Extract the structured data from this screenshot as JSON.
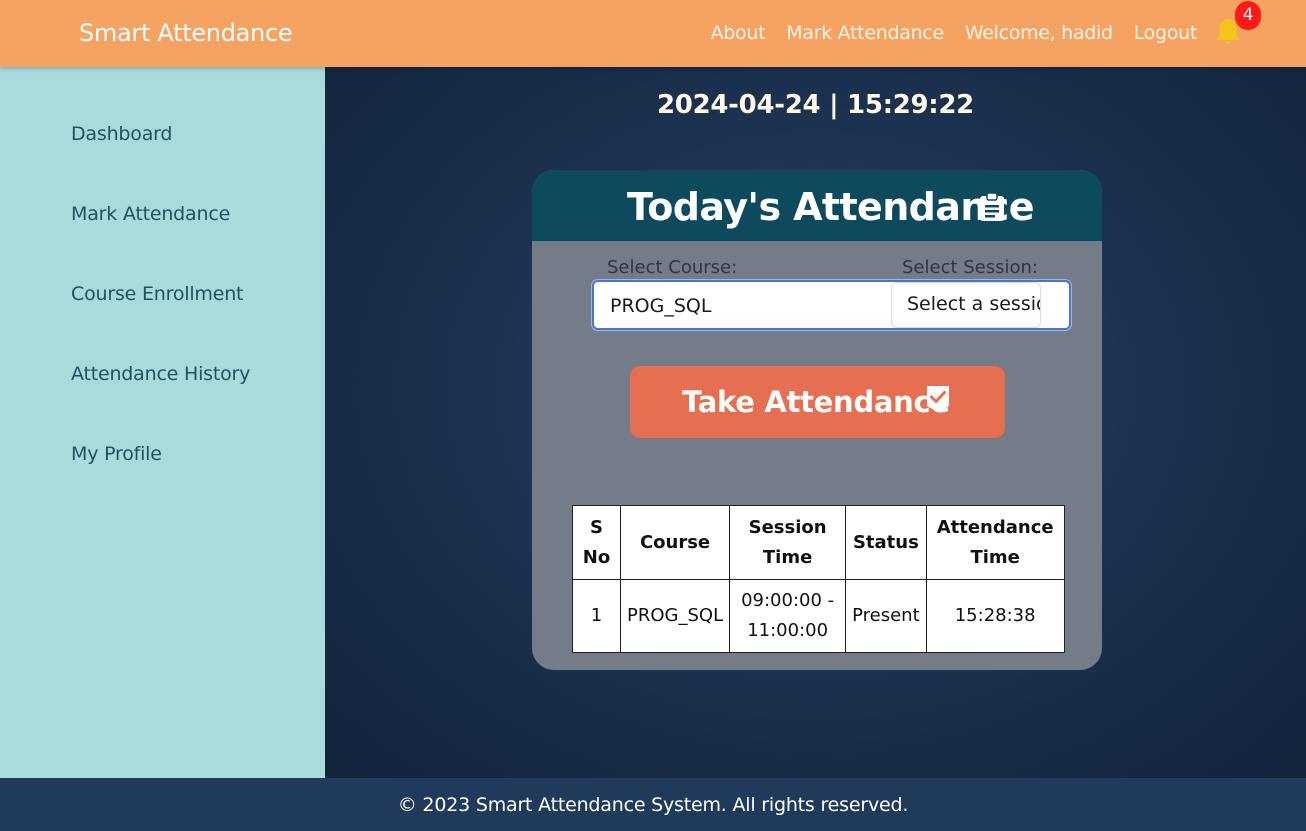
{
  "navbar": {
    "brand": "Smart Attendance",
    "links": [
      "About",
      "Mark Attendance",
      "Welcome, hadid",
      "Logout"
    ],
    "notification_count": "4"
  },
  "sidebar": {
    "items": [
      "Dashboard",
      "Mark Attendance",
      "Course Enrollment",
      "Attendance History",
      "My Profile"
    ]
  },
  "main": {
    "datetime": "2024-04-24 | 15:29:22",
    "card": {
      "title": "Today's Attendance",
      "course_label": "Select Course:",
      "session_label": "Select Session:",
      "course_value": "PROG_SQL",
      "session_value": "Select a session",
      "take_button": "Take Attendance"
    },
    "table": {
      "headers": [
        "S No",
        "Course",
        "Session Time",
        "Status",
        "Attendance Time"
      ],
      "rows": [
        [
          "1",
          "PROG_SQL",
          "09:00:00 - 11:00:00",
          "Present",
          "15:28:38"
        ]
      ]
    }
  },
  "footer": {
    "text": "© 2023 Smart Attendance System. All rights reserved."
  },
  "colors": {
    "navbar": "#f4a363",
    "sidebar": "#a9dadc",
    "card_header": "#0e4a5e",
    "take_button": "#e56f50",
    "footer": "#203a5c",
    "badge": "#ff1a1a",
    "bell": "#f6c21c"
  },
  "icons": {
    "notification": "bell-icon",
    "card_title": "clipboard-icon",
    "take_button": "check-badge-icon"
  }
}
